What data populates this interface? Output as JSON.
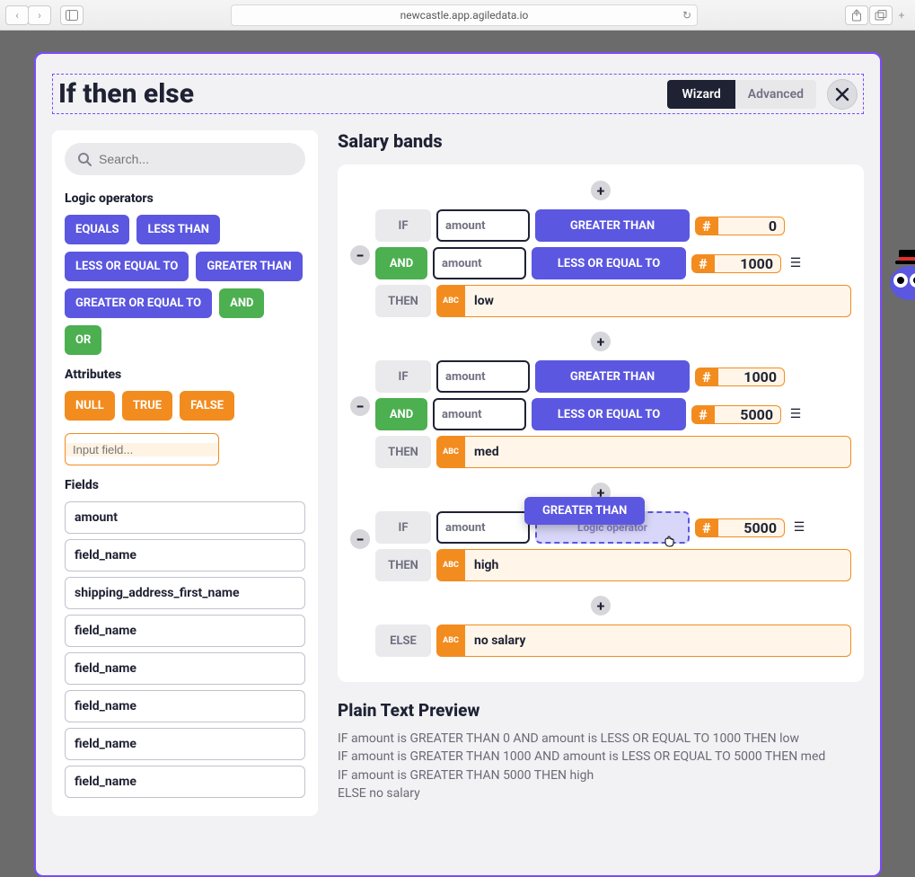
{
  "browser": {
    "url": "newcastle.app.agiledata.io"
  },
  "modal": {
    "title": "If then else",
    "tabs": {
      "wizard": "Wizard",
      "advanced": "Advanced"
    }
  },
  "sidebar": {
    "search_placeholder": "Search...",
    "logic_label": "Logic operators",
    "logic": [
      "EQUALS",
      "LESS THAN",
      "LESS OR EQUAL TO",
      "GREATER THAN",
      "GREATER OR EQUAL TO",
      "AND",
      "OR"
    ],
    "attr_label": "Attributes",
    "attrs": [
      "NULL",
      "TRUE",
      "FALSE"
    ],
    "attr_input_placeholder": "Input field...",
    "fields_label": "Fields",
    "fields": [
      "amount",
      "field_name",
      "shipping_address_first_name",
      "field_name",
      "field_name",
      "field_name",
      "field_name",
      "field_name"
    ]
  },
  "rule": {
    "title": "Salary bands",
    "kw": {
      "if": "IF",
      "and": "AND",
      "then": "THEN",
      "else": "ELSE",
      "hash": "#",
      "abc": "ABC"
    },
    "blocks": [
      {
        "conds": [
          {
            "join": "IF",
            "field": "amount",
            "op": "GREATER THAN",
            "val": "0"
          },
          {
            "join": "AND",
            "field": "amount",
            "op": "LESS OR EQUAL TO",
            "val": "1000"
          }
        ],
        "then": "low"
      },
      {
        "conds": [
          {
            "join": "IF",
            "field": "amount",
            "op": "GREATER THAN",
            "val": "1000"
          },
          {
            "join": "AND",
            "field": "amount",
            "op": "LESS OR EQUAL TO",
            "val": "5000"
          }
        ],
        "then": "med"
      },
      {
        "conds": [
          {
            "join": "IF",
            "field": "amount",
            "op_drop": "Logic operator",
            "drag": "GREATER THAN",
            "val": "5000"
          }
        ],
        "then": "high"
      }
    ],
    "else": "no salary"
  },
  "preview": {
    "heading": "Plain Text Preview",
    "lines": [
      "IF amount is GREATER THAN 0 AND amount is LESS OR EQUAL TO 1000 THEN low",
      "IF amount is GREATER THAN 1000 AND amount is LESS OR EQUAL TO 5000 THEN med",
      "IF amount is GREATER THAN 5000 THEN high",
      "ELSE no salary"
    ]
  }
}
